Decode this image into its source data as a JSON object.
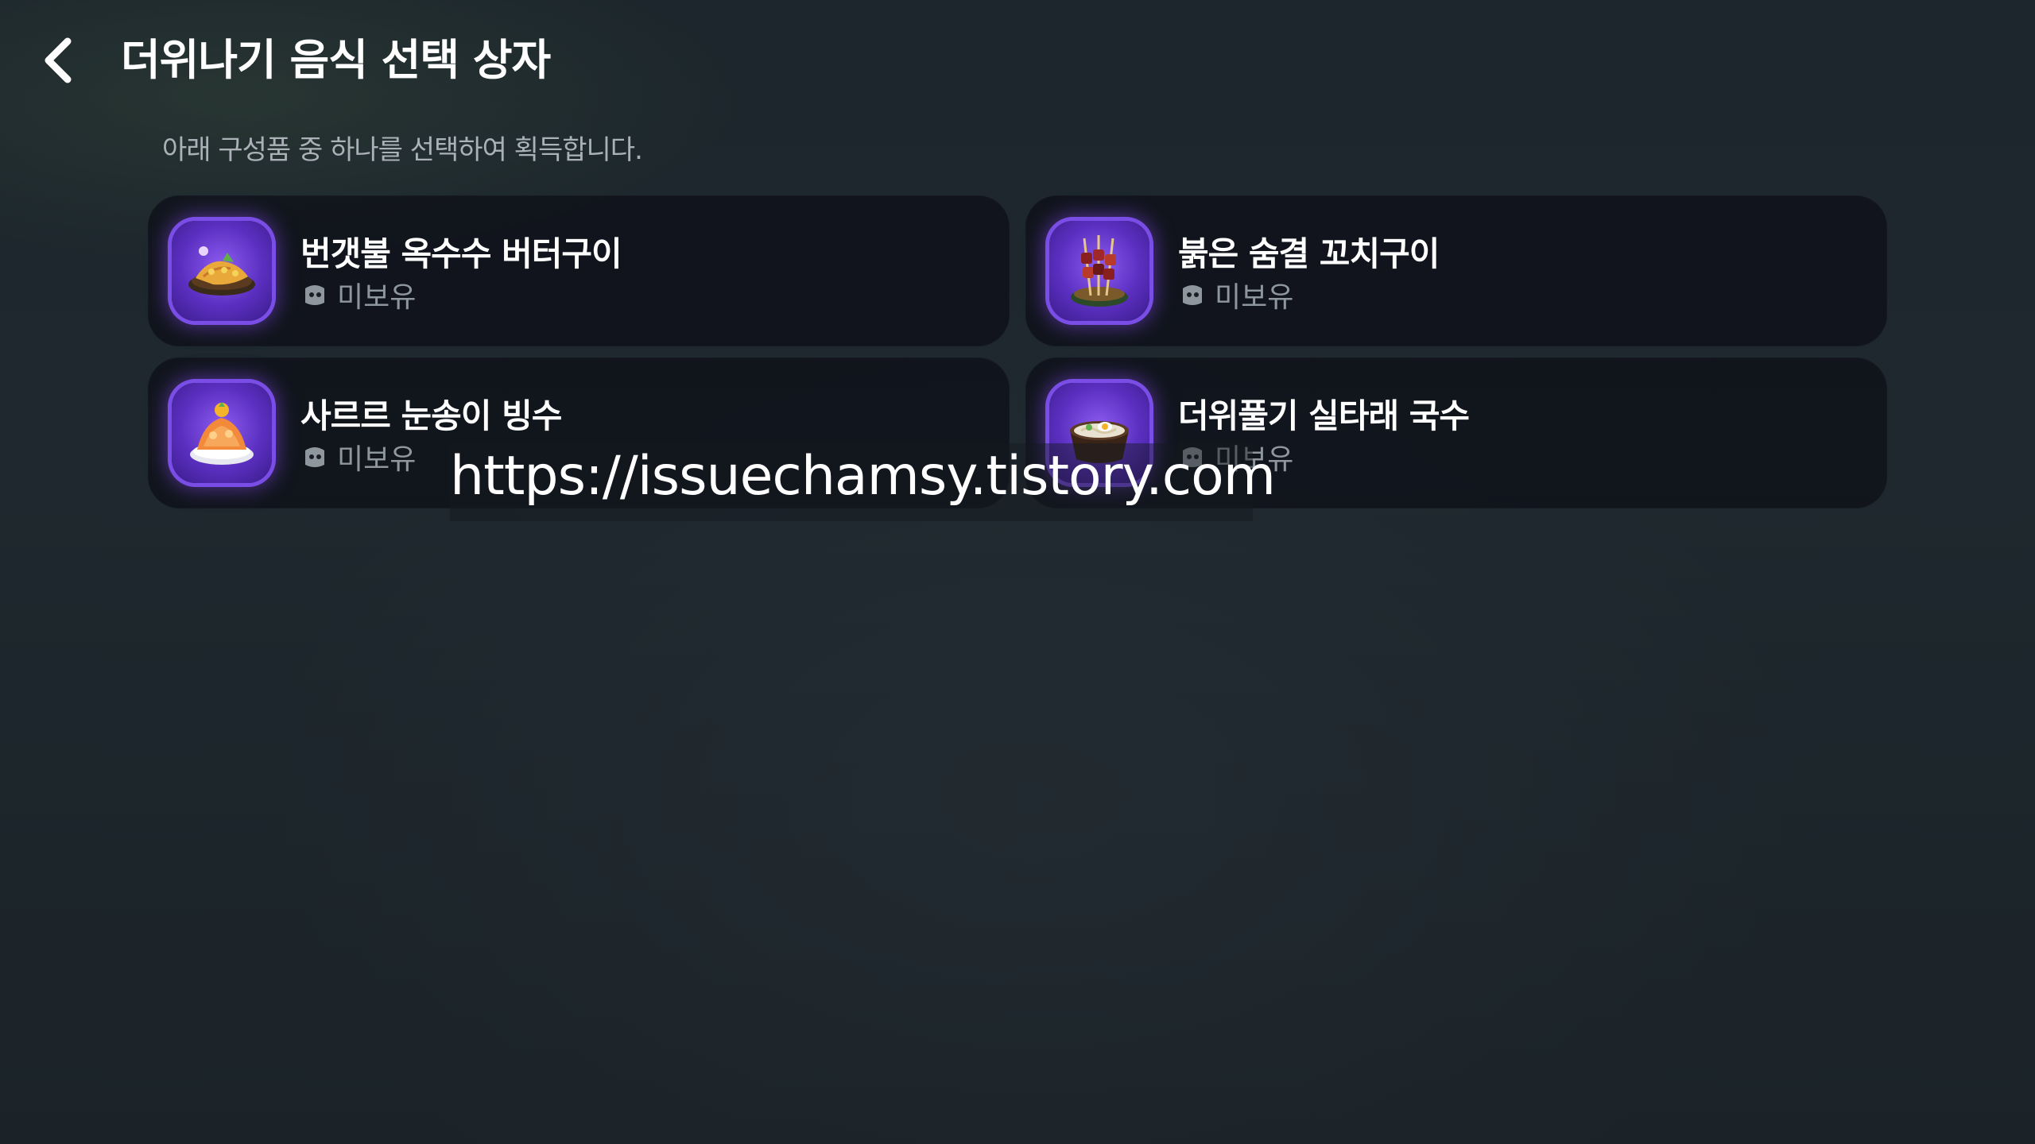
{
  "header": {
    "title": "더위나기 음식 선택 상자",
    "back_icon": "chevron-left-icon"
  },
  "subtitle": "아래 구성품 중 하나를 선택하여 획득합니다.",
  "items": [
    {
      "name": "번갯불 옥수수 버터구이",
      "status": "미보유",
      "icon": "grilled-corn-icon"
    },
    {
      "name": "붉은 숨결 꼬치구이",
      "status": "미보유",
      "icon": "skewer-icon"
    },
    {
      "name": "사르르 눈송이 빙수",
      "status": "미보유",
      "icon": "shaved-ice-icon"
    },
    {
      "name": "더위풀기 실타래 국수",
      "status": "미보유",
      "icon": "noodle-bowl-icon"
    }
  ],
  "colors": {
    "accent_purple": "#7a4ee6",
    "card_bg": "#0c0e16",
    "status_gray": "#8e969e"
  },
  "watermark": "https://issuechamsy.tistory.com"
}
